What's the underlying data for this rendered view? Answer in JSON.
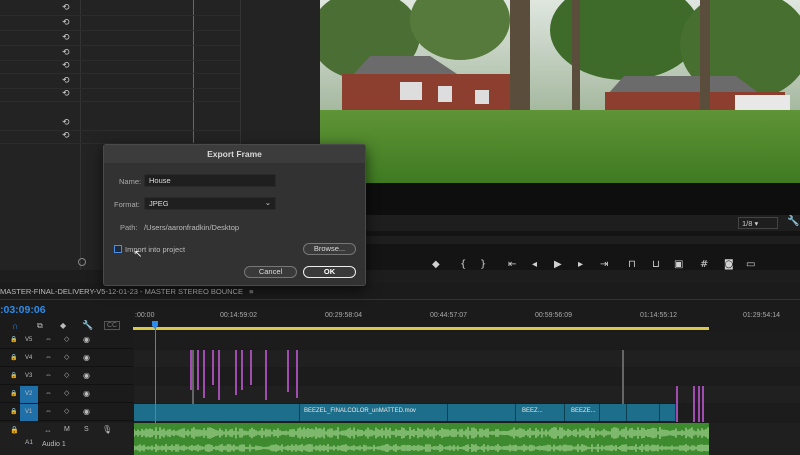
{
  "dialog": {
    "title": "Export Frame",
    "name_label": "Name:",
    "name_value": "House",
    "format_label": "Format:",
    "format_value": "JPEG",
    "path_label": "Path:",
    "path_value": "/Users/aaronfradkin/Desktop",
    "import_label": "Import into project",
    "import_checked": false,
    "browse_label": "Browse...",
    "cancel_label": "Cancel",
    "ok_label": "OK"
  },
  "monitor": {
    "zoom_value": "1/8"
  },
  "timeline": {
    "sequence_title": "MASTER-FINAL-DELIVERY-V5-12-01-23 - MASTER STEREO BOUNCE",
    "menu_icon": "≡",
    "timecode": ":03:09:06",
    "ruler": [
      ":00:00",
      "00:14:59:02",
      "00:29:58:04",
      "00:44:57:07",
      "00:59:56:09",
      "01:14:55:12",
      "01:29:54:14"
    ],
    "tracks": [
      {
        "label": "V5"
      },
      {
        "label": "V4"
      },
      {
        "label": "V3"
      },
      {
        "label": "V2"
      },
      {
        "label": "V1"
      }
    ],
    "audio_track": {
      "label": "A1",
      "name": "Audio 1",
      "m": "M",
      "s": "S"
    },
    "clips": [
      {
        "name": "BEEZEL_FINALCOLOR_unMATTED.mov"
      },
      {
        "name": "BEEZ..."
      },
      {
        "name": "BEEZE..."
      }
    ]
  },
  "colors": {
    "accent": "#2d8ceb",
    "video_clip": "#1d6e8b",
    "audio_clip": "#3e8b2f",
    "marker": "#a04cb0"
  }
}
